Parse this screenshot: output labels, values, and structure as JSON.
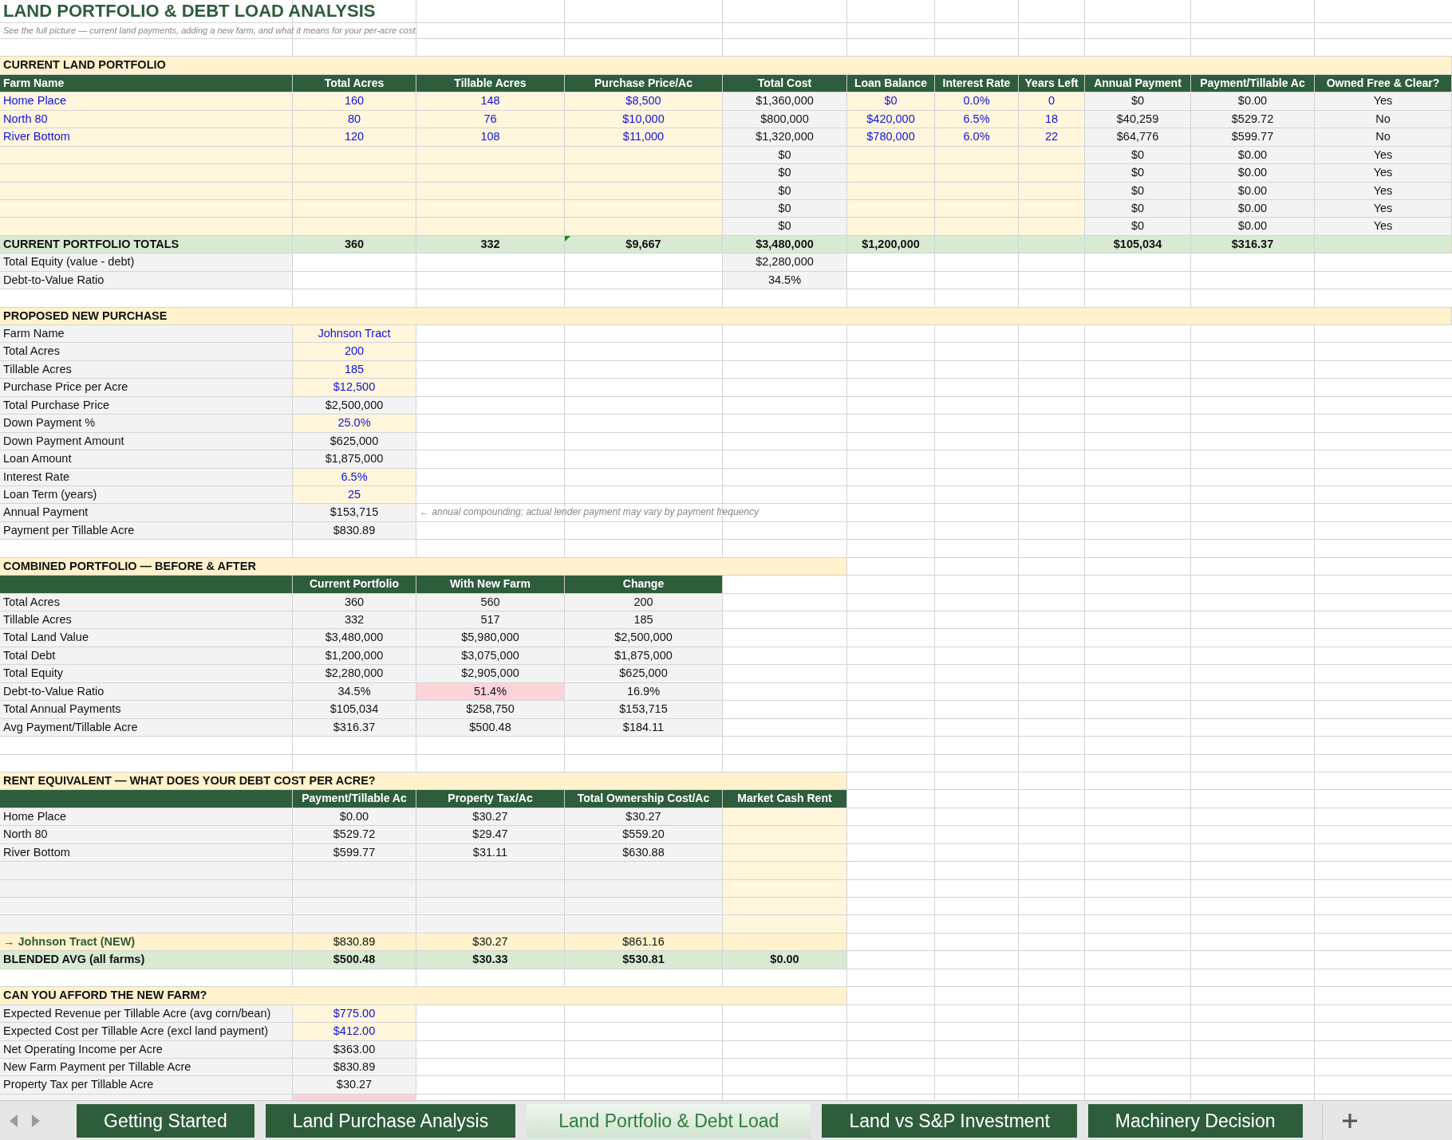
{
  "title": "LAND PORTFOLIO & DEBT LOAD ANALYSIS",
  "subtitle": "See the full picture — current land payments, adding a new farm, and what it means for your per-acre cost.",
  "rows": [
    {
      "kind": "blank"
    },
    {
      "kind": "section",
      "wide": true,
      "label": "CURRENT LAND PORTFOLIO"
    },
    {
      "kind": "header",
      "cells": [
        {
          "text": "Farm Name"
        },
        {
          "text": "Total Acres"
        },
        {
          "text": "Tillable Acres"
        },
        {
          "text": "Purchase Price/Ac"
        },
        {
          "text": "Total Cost"
        },
        {
          "text": "Loan Balance"
        },
        {
          "text": "Interest Rate"
        },
        {
          "text": "Years Left"
        },
        {
          "text": "Annual Payment"
        },
        {
          "text": "Payment/Tillable Ac"
        },
        {
          "text": "Owned Free & Clear?"
        }
      ]
    },
    {
      "kind": "data",
      "cells": [
        {
          "text": "Home Place",
          "kind": "input"
        },
        {
          "text": "160",
          "kind": "input"
        },
        {
          "text": "148",
          "kind": "input"
        },
        {
          "text": "$8,500",
          "kind": "input"
        },
        {
          "text": "$1,360,000",
          "kind": "calc"
        },
        {
          "text": "$0",
          "kind": "input"
        },
        {
          "text": "0.0%",
          "kind": "input"
        },
        {
          "text": "0",
          "kind": "input"
        },
        {
          "text": "$0",
          "kind": "calc"
        },
        {
          "text": "$0.00",
          "kind": "calc"
        },
        {
          "text": "Yes",
          "kind": "calc"
        }
      ]
    },
    {
      "kind": "data",
      "cells": [
        {
          "text": "North 80",
          "kind": "input"
        },
        {
          "text": "80",
          "kind": "input"
        },
        {
          "text": "76",
          "kind": "input"
        },
        {
          "text": "$10,000",
          "kind": "input"
        },
        {
          "text": "$800,000",
          "kind": "calc"
        },
        {
          "text": "$420,000",
          "kind": "input"
        },
        {
          "text": "6.5%",
          "kind": "input"
        },
        {
          "text": "18",
          "kind": "input"
        },
        {
          "text": "$40,259",
          "kind": "calc"
        },
        {
          "text": "$529.72",
          "kind": "calc"
        },
        {
          "text": "No",
          "kind": "calc"
        }
      ]
    },
    {
      "kind": "data",
      "cells": [
        {
          "text": "River Bottom",
          "kind": "input"
        },
        {
          "text": "120",
          "kind": "input"
        },
        {
          "text": "108",
          "kind": "input"
        },
        {
          "text": "$11,000",
          "kind": "input"
        },
        {
          "text": "$1,320,000",
          "kind": "calc"
        },
        {
          "text": "$780,000",
          "kind": "input"
        },
        {
          "text": "6.0%",
          "kind": "input"
        },
        {
          "text": "22",
          "kind": "input"
        },
        {
          "text": "$64,776",
          "kind": "calc"
        },
        {
          "text": "$599.77",
          "kind": "calc"
        },
        {
          "text": "No",
          "kind": "calc"
        }
      ]
    },
    {
      "kind": "data",
      "cells": [
        {
          "kind": "input"
        },
        {
          "kind": "input"
        },
        {
          "kind": "input"
        },
        {
          "kind": "input"
        },
        {
          "text": "$0",
          "kind": "calc"
        },
        {
          "kind": "input"
        },
        {
          "kind": "input"
        },
        {
          "kind": "input"
        },
        {
          "text": "$0",
          "kind": "calc"
        },
        {
          "text": "$0.00",
          "kind": "calc"
        },
        {
          "text": "Yes",
          "kind": "calc"
        }
      ]
    },
    {
      "kind": "data",
      "cells": [
        {
          "kind": "input"
        },
        {
          "kind": "input"
        },
        {
          "kind": "input"
        },
        {
          "kind": "input"
        },
        {
          "text": "$0",
          "kind": "calc"
        },
        {
          "kind": "input"
        },
        {
          "kind": "input"
        },
        {
          "kind": "input"
        },
        {
          "text": "$0",
          "kind": "calc"
        },
        {
          "text": "$0.00",
          "kind": "calc"
        },
        {
          "text": "Yes",
          "kind": "calc"
        }
      ]
    },
    {
      "kind": "data",
      "cells": [
        {
          "kind": "input"
        },
        {
          "kind": "input"
        },
        {
          "kind": "input"
        },
        {
          "kind": "input"
        },
        {
          "text": "$0",
          "kind": "calc"
        },
        {
          "kind": "input"
        },
        {
          "kind": "input"
        },
        {
          "kind": "input"
        },
        {
          "text": "$0",
          "kind": "calc"
        },
        {
          "text": "$0.00",
          "kind": "calc"
        },
        {
          "text": "Yes",
          "kind": "calc"
        }
      ]
    },
    {
      "kind": "data",
      "cells": [
        {
          "kind": "input"
        },
        {
          "kind": "input"
        },
        {
          "kind": "input"
        },
        {
          "kind": "input"
        },
        {
          "text": "$0",
          "kind": "calc"
        },
        {
          "kind": "input"
        },
        {
          "kind": "input"
        },
        {
          "kind": "input"
        },
        {
          "text": "$0",
          "kind": "calc"
        },
        {
          "text": "$0.00",
          "kind": "calc"
        },
        {
          "text": "Yes",
          "kind": "calc"
        }
      ]
    },
    {
      "kind": "data",
      "cells": [
        {
          "kind": "input"
        },
        {
          "kind": "input"
        },
        {
          "kind": "input"
        },
        {
          "kind": "input"
        },
        {
          "text": "$0",
          "kind": "calc"
        },
        {
          "kind": "input"
        },
        {
          "kind": "input"
        },
        {
          "kind": "input"
        },
        {
          "text": "$0",
          "kind": "calc"
        },
        {
          "text": "$0.00",
          "kind": "calc"
        },
        {
          "text": "Yes",
          "kind": "calc"
        }
      ]
    },
    {
      "kind": "total",
      "cells": [
        {
          "text": "CURRENT PORTFOLIO TOTALS"
        },
        {
          "text": "360"
        },
        {
          "text": "332"
        },
        {
          "text": "$9,667",
          "comment": true
        },
        {
          "text": "$3,480,000"
        },
        {
          "text": "$1,200,000"
        },
        {},
        {},
        {
          "text": "$105,034"
        },
        {
          "text": "$316.37"
        },
        {}
      ]
    },
    {
      "kind": "data",
      "cells": [
        {
          "text": "Total Equity (value - debt)",
          "kind": "label"
        },
        {
          "kind": "plain"
        },
        {
          "kind": "plain"
        },
        {
          "kind": "plain"
        },
        {
          "text": "$2,280,000",
          "kind": "calc"
        }
      ]
    },
    {
      "kind": "data",
      "cells": [
        {
          "text": "Debt-to-Value Ratio",
          "kind": "label"
        },
        {
          "kind": "plain"
        },
        {
          "kind": "plain"
        },
        {
          "kind": "plain"
        },
        {
          "text": "34.5%",
          "kind": "calc"
        }
      ]
    },
    {
      "kind": "blank"
    },
    {
      "kind": "section",
      "wide": true,
      "label": "PROPOSED NEW PURCHASE"
    },
    {
      "kind": "data",
      "cells": [
        {
          "text": "Farm Name",
          "kind": "label"
        },
        {
          "text": "Johnson Tract",
          "kind": "input"
        }
      ]
    },
    {
      "kind": "data",
      "cells": [
        {
          "text": "Total Acres",
          "kind": "label"
        },
        {
          "text": "200",
          "kind": "input"
        }
      ]
    },
    {
      "kind": "data",
      "cells": [
        {
          "text": "Tillable Acres",
          "kind": "label"
        },
        {
          "text": "185",
          "kind": "input"
        }
      ]
    },
    {
      "kind": "data",
      "cells": [
        {
          "text": "Purchase Price per Acre",
          "kind": "label"
        },
        {
          "text": "$12,500",
          "kind": "input"
        }
      ]
    },
    {
      "kind": "data",
      "cells": [
        {
          "text": "Total Purchase Price",
          "kind": "label"
        },
        {
          "text": "$2,500,000",
          "kind": "calc"
        }
      ]
    },
    {
      "kind": "data",
      "cells": [
        {
          "text": "Down Payment %",
          "kind": "label"
        },
        {
          "text": "25.0%",
          "kind": "input"
        }
      ]
    },
    {
      "kind": "data",
      "cells": [
        {
          "text": "Down Payment Amount",
          "kind": "label"
        },
        {
          "text": "$625,000",
          "kind": "calc"
        }
      ]
    },
    {
      "kind": "data",
      "cells": [
        {
          "text": "Loan Amount",
          "kind": "label"
        },
        {
          "text": "$1,875,000",
          "kind": "calc"
        }
      ]
    },
    {
      "kind": "data",
      "cells": [
        {
          "text": "Interest Rate",
          "kind": "label"
        },
        {
          "text": "6.5%",
          "kind": "input"
        }
      ]
    },
    {
      "kind": "data",
      "cells": [
        {
          "text": "Loan Term (years)",
          "kind": "label"
        },
        {
          "text": "25",
          "kind": "input"
        }
      ]
    },
    {
      "kind": "data",
      "cells": [
        {
          "text": "Annual Payment",
          "kind": "label"
        },
        {
          "text": "$153,715",
          "kind": "calc"
        },
        {
          "text": "← annual compounding; actual lender payment may vary by payment frequency",
          "kind": "note"
        }
      ]
    },
    {
      "kind": "data",
      "cells": [
        {
          "text": "Payment per Tillable Acre",
          "kind": "label"
        },
        {
          "text": "$830.89",
          "kind": "calc"
        }
      ]
    },
    {
      "kind": "blank"
    },
    {
      "kind": "section",
      "wide": false,
      "label": "COMBINED PORTFOLIO — BEFORE & AFTER"
    },
    {
      "kind": "header",
      "cells": [
        {},
        {
          "text": "Current Portfolio"
        },
        {
          "text": "With New Farm"
        },
        {
          "text": "Change"
        }
      ]
    },
    {
      "kind": "data",
      "cells": [
        {
          "text": "Total Acres",
          "kind": "label"
        },
        {
          "text": "360",
          "kind": "calc"
        },
        {
          "text": "560",
          "kind": "calc"
        },
        {
          "text": "200",
          "kind": "calc"
        }
      ]
    },
    {
      "kind": "data",
      "cells": [
        {
          "text": "Tillable Acres",
          "kind": "label"
        },
        {
          "text": "332",
          "kind": "calc"
        },
        {
          "text": "517",
          "kind": "calc"
        },
        {
          "text": "185",
          "kind": "calc"
        }
      ]
    },
    {
      "kind": "data",
      "cells": [
        {
          "text": "Total Land Value",
          "kind": "label"
        },
        {
          "text": "$3,480,000",
          "kind": "calc"
        },
        {
          "text": "$5,980,000",
          "kind": "calc"
        },
        {
          "text": "$2,500,000",
          "kind": "calc"
        }
      ]
    },
    {
      "kind": "data",
      "cells": [
        {
          "text": "Total Debt",
          "kind": "label"
        },
        {
          "text": "$1,200,000",
          "kind": "calc"
        },
        {
          "text": "$3,075,000",
          "kind": "calc"
        },
        {
          "text": "$1,875,000",
          "kind": "calc"
        }
      ]
    },
    {
      "kind": "data",
      "cells": [
        {
          "text": "Total Equity",
          "kind": "label"
        },
        {
          "text": "$2,280,000",
          "kind": "calc"
        },
        {
          "text": "$2,905,000",
          "kind": "calc"
        },
        {
          "text": "$625,000",
          "kind": "calc"
        }
      ]
    },
    {
      "kind": "data",
      "cells": [
        {
          "text": "Debt-to-Value Ratio",
          "kind": "label"
        },
        {
          "text": "34.5%",
          "kind": "calc"
        },
        {
          "text": "51.4%",
          "kind": "alert"
        },
        {
          "text": "16.9%",
          "kind": "calc"
        }
      ]
    },
    {
      "kind": "data",
      "cells": [
        {
          "text": "Total Annual Payments",
          "kind": "label"
        },
        {
          "text": "$105,034",
          "kind": "calc"
        },
        {
          "text": "$258,750",
          "kind": "calc"
        },
        {
          "text": "$153,715",
          "kind": "calc"
        }
      ]
    },
    {
      "kind": "data",
      "cells": [
        {
          "text": "Avg Payment/Tillable Acre",
          "kind": "label"
        },
        {
          "text": "$316.37",
          "kind": "calc"
        },
        {
          "text": "$500.48",
          "kind": "calc"
        },
        {
          "text": "$184.11",
          "kind": "calc"
        }
      ]
    },
    {
      "kind": "blank"
    },
    {
      "kind": "blank"
    },
    {
      "kind": "section",
      "wide": false,
      "label": "RENT EQUIVALENT — WHAT DOES YOUR DEBT COST PER ACRE?"
    },
    {
      "kind": "header",
      "cells": [
        {},
        {
          "text": "Payment/Tillable Ac"
        },
        {
          "text": "Property Tax/Ac"
        },
        {
          "text": "Total Ownership Cost/Ac"
        },
        {
          "text": "Market Cash Rent"
        }
      ]
    },
    {
      "kind": "data",
      "cells": [
        {
          "text": "Home Place",
          "kind": "label"
        },
        {
          "text": "$0.00",
          "kind": "calc"
        },
        {
          "text": "$30.27",
          "kind": "calc"
        },
        {
          "text": "$30.27",
          "kind": "calc"
        },
        {
          "kind": "input"
        }
      ]
    },
    {
      "kind": "data",
      "cells": [
        {
          "text": "North 80",
          "kind": "label"
        },
        {
          "text": "$529.72",
          "kind": "calc"
        },
        {
          "text": "$29.47",
          "kind": "calc"
        },
        {
          "text": "$559.20",
          "kind": "calc"
        },
        {
          "kind": "input"
        }
      ]
    },
    {
      "kind": "data",
      "cells": [
        {
          "text": "River Bottom",
          "kind": "label"
        },
        {
          "text": "$599.77",
          "kind": "calc"
        },
        {
          "text": "$31.11",
          "kind": "calc"
        },
        {
          "text": "$630.88",
          "kind": "calc"
        },
        {
          "kind": "input"
        }
      ]
    },
    {
      "kind": "data",
      "cells": [
        {
          "kind": "label"
        },
        {
          "kind": "calc"
        },
        {
          "kind": "calc"
        },
        {
          "kind": "calc"
        },
        {
          "kind": "input"
        }
      ]
    },
    {
      "kind": "data",
      "cells": [
        {
          "kind": "label"
        },
        {
          "kind": "calc"
        },
        {
          "kind": "calc"
        },
        {
          "kind": "calc"
        },
        {
          "kind": "input"
        }
      ]
    },
    {
      "kind": "data",
      "cells": [
        {
          "kind": "label"
        },
        {
          "kind": "calc"
        },
        {
          "kind": "calc"
        },
        {
          "kind": "calc"
        },
        {
          "kind": "input"
        }
      ]
    },
    {
      "kind": "data",
      "cells": [
        {
          "kind": "label"
        },
        {
          "kind": "calc"
        },
        {
          "kind": "calc"
        },
        {
          "kind": "calc"
        },
        {
          "kind": "input"
        }
      ]
    },
    {
      "kind": "data",
      "cells": [
        {
          "text": "→ Johnson Tract (NEW)",
          "kind": "new-label"
        },
        {
          "text": "$830.89",
          "kind": "new"
        },
        {
          "text": "$30.27",
          "kind": "new"
        },
        {
          "text": "$861.16",
          "kind": "new"
        },
        {
          "kind": "new"
        }
      ]
    },
    {
      "kind": "total",
      "cells": [
        {
          "text": "BLENDED AVG (all farms)"
        },
        {
          "text": "$500.48"
        },
        {
          "text": "$30.33"
        },
        {
          "text": "$530.81"
        },
        {
          "text": "$0.00"
        }
      ]
    },
    {
      "kind": "blank"
    },
    {
      "kind": "section",
      "wide": false,
      "label": "CAN YOU AFFORD THE NEW FARM?"
    },
    {
      "kind": "data",
      "cells": [
        {
          "text": "Expected Revenue per Tillable Acre (avg corn/bean)",
          "kind": "label"
        },
        {
          "text": "$775.00",
          "kind": "input"
        }
      ]
    },
    {
      "kind": "data",
      "cells": [
        {
          "text": "Expected Cost per Tillable Acre (excl land payment)",
          "kind": "label"
        },
        {
          "text": "$412.00",
          "kind": "input"
        }
      ]
    },
    {
      "kind": "data",
      "cells": [
        {
          "text": "Net Operating Income per Acre",
          "kind": "label"
        },
        {
          "text": "$363.00",
          "kind": "calc"
        }
      ]
    },
    {
      "kind": "data",
      "cells": [
        {
          "text": "New Farm Payment per Tillable Acre",
          "kind": "label"
        },
        {
          "text": "$830.89",
          "kind": "calc"
        }
      ]
    },
    {
      "kind": "data",
      "cells": [
        {
          "text": "Property Tax per Tillable Acre",
          "kind": "label"
        },
        {
          "text": "$30.27",
          "kind": "calc"
        }
      ]
    },
    {
      "kind": "data",
      "cells": [
        {
          "kind": "label"
        },
        {
          "kind": "alert"
        }
      ]
    }
  ],
  "tabs": [
    {
      "label": "Getting Started",
      "selected": false
    },
    {
      "label": "Land Purchase Analysis",
      "selected": false
    },
    {
      "label": "Land Portfolio & Debt Load",
      "selected": true
    },
    {
      "label": "Land vs S&P Investment",
      "selected": false
    },
    {
      "label": "Machinery Decision",
      "selected": false
    }
  ]
}
